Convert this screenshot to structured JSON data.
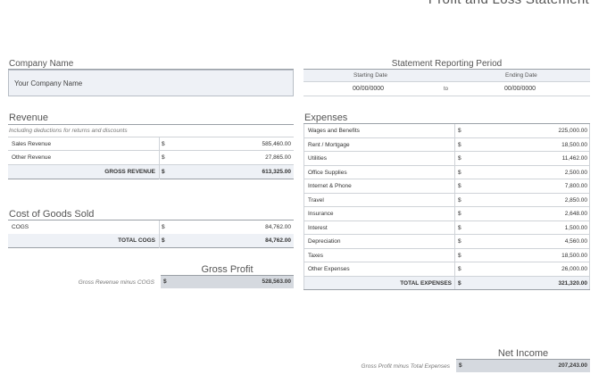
{
  "title": "Profit and Loss Statement",
  "company": {
    "label": "Company Name",
    "value": "Your Company Name"
  },
  "period": {
    "label": "Statement Reporting Period",
    "start_label": "Starting Date",
    "end_label": "Ending Date",
    "start": "00/00/0000",
    "to": "to",
    "end": "00/00/0000"
  },
  "revenue": {
    "label": "Revenue",
    "note": "Including deductions for returns and discounts",
    "rows": [
      {
        "name": "Sales Revenue",
        "cur": "$",
        "amount": "585,460.00"
      },
      {
        "name": "Other Revenue",
        "cur": "$",
        "amount": "27,865.00"
      }
    ],
    "total_label": "GROSS REVENUE",
    "total_cur": "$",
    "total": "613,325.00"
  },
  "cogs": {
    "label": "Cost of Goods Sold",
    "rows": [
      {
        "name": "COGS",
        "cur": "$",
        "amount": "84,762.00"
      }
    ],
    "total_label": "TOTAL COGS",
    "total_cur": "$",
    "total": "84,762.00"
  },
  "gross_profit": {
    "label": "Gross Profit",
    "note": "Gross Revenue minus COGS",
    "cur": "$",
    "value": "528,563.00"
  },
  "expenses": {
    "label": "Expenses",
    "rows": [
      {
        "name": "Wages and Benefits",
        "cur": "$",
        "amount": "225,000.00"
      },
      {
        "name": "Rent / Mortgage",
        "cur": "$",
        "amount": "18,500.00"
      },
      {
        "name": "Utilities",
        "cur": "$",
        "amount": "11,462.00"
      },
      {
        "name": "Office Supplies",
        "cur": "$",
        "amount": "2,500.00"
      },
      {
        "name": "Internet & Phone",
        "cur": "$",
        "amount": "7,800.00"
      },
      {
        "name": "Travel",
        "cur": "$",
        "amount": "2,850.00"
      },
      {
        "name": "Insurance",
        "cur": "$",
        "amount": "2,648.00"
      },
      {
        "name": "Interest",
        "cur": "$",
        "amount": "1,500.00"
      },
      {
        "name": "Depreciation",
        "cur": "$",
        "amount": "4,560.00"
      },
      {
        "name": "Taxes",
        "cur": "$",
        "amount": "18,500.00"
      },
      {
        "name": "Other Expenses",
        "cur": "$",
        "amount": "26,000.00"
      }
    ],
    "total_label": "TOTAL EXPENSES",
    "total_cur": "$",
    "total": "321,320.00"
  },
  "net_income": {
    "label": "Net Income",
    "note": "Gross Profit minus Total Expenses",
    "cur": "$",
    "value": "207,243.00"
  }
}
